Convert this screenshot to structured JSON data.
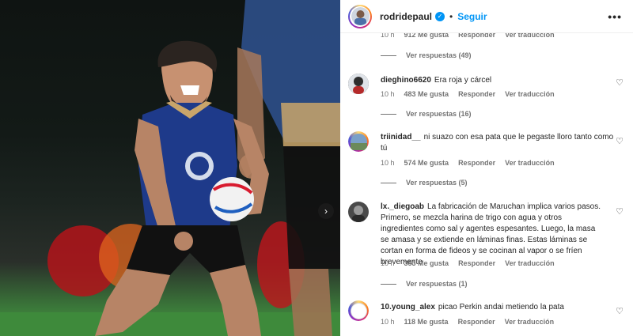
{
  "post": {
    "username": "rodridepaul",
    "follow_label": "Seguir",
    "more_icon": "more-options-icon"
  },
  "top_meta": {
    "time": "10 h",
    "likes": "912 Me gusta",
    "reply": "Responder",
    "translate": "Ver traducción"
  },
  "top_replies": "Ver respuestas (49)",
  "comments": [
    {
      "user": "dieghino6620",
      "text": "Era roja y cárcel",
      "time": "10 h",
      "likes": "483 Me gusta",
      "reply": "Responder",
      "translate": "Ver traducción",
      "replies": "Ver respuestas (16)"
    },
    {
      "user": "triinidad__",
      "text": "ni suazo con esa pata que le pegaste lloro tanto como tú",
      "time": "10 h",
      "likes": "574 Me gusta",
      "reply": "Responder",
      "translate": "Ver traducción",
      "replies": "Ver respuestas (5)"
    },
    {
      "user": "lx._diegoab",
      "text": "La fabricación de Maruchan implica varios pasos. Primero, se mezcla harina de trigo con agua y otros ingredientes como sal y agentes espesantes. Luego, la masa se amasa y se extiende en láminas finas. Estas láminas se cortan en forma de fideos y se cocinan al vapor o se fríen brevemente",
      "time": "10 h",
      "likes": "353 Me gusta",
      "reply": "Responder",
      "translate": "Ver traducción",
      "replies": "Ver respuestas (1)"
    },
    {
      "user": "10.young_alex",
      "text": "picao Perkin andai metiendo la pata",
      "time": "10 h",
      "likes": "118 Me gusta",
      "reply": "Responder",
      "translate": "Ver traducción"
    }
  ],
  "colors": {
    "accent": "#0095f6",
    "text": "#262626",
    "muted": "#737373"
  }
}
